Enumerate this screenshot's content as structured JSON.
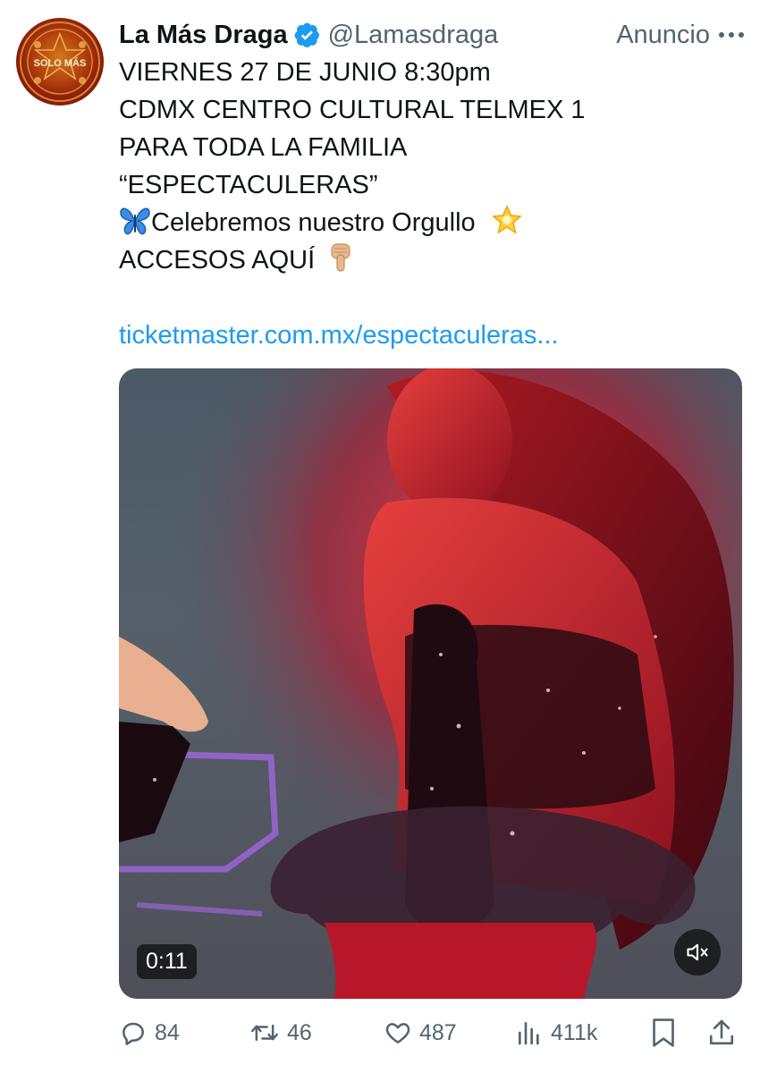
{
  "author": {
    "display_name": "La Más Draga",
    "handle": "@Lamasdraga",
    "verified": true,
    "avatar_icon": "la-mas-draga-logo-icon",
    "avatar_text": "SOLO MÁS"
  },
  "ad_label": "Anuncio",
  "tweet": {
    "lines": [
      "VIERNES 27 DE JUNIO 8:30pm",
      "CDMX CENTRO CULTURAL TELMEX 1",
      "PARA TODA LA FAMILIA",
      "“ESPECTACULERAS”",
      "Celebremos nuestro Orgullo",
      "ACCESOS AQUÍ"
    ],
    "emoji": {
      "butterfly": "butterfly-emoji",
      "star": "glowing-star-emoji",
      "pointing": "backhand-index-pointing-down-emoji"
    },
    "link": "ticketmaster.com.mx/espectaculeras..."
  },
  "media": {
    "type": "video",
    "duration": "0:11",
    "muted": true
  },
  "actions": {
    "replies": "84",
    "retweets": "46",
    "likes": "487",
    "views": "411k"
  },
  "colors": {
    "link": "#1d9bf0",
    "secondary_text": "#536471",
    "verified_badge": "#1d9bf0"
  }
}
